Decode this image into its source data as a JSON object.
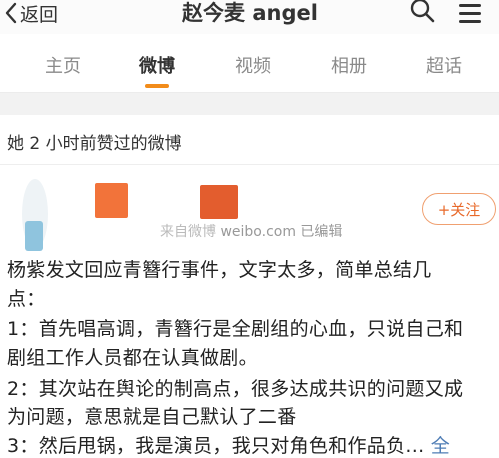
{
  "header": {
    "back_label": "返回",
    "title": "赵今麦 angel"
  },
  "tabs": [
    {
      "label": "主页",
      "active": false
    },
    {
      "label": "微博",
      "active": true
    },
    {
      "label": "视频",
      "active": false
    },
    {
      "label": "相册",
      "active": false
    },
    {
      "label": "超话",
      "active": false
    }
  ],
  "liked_section": {
    "label": "她 2 小时前赞过的微博"
  },
  "post": {
    "source_blurred": "来自微博",
    "source": "weibo.com 已编辑",
    "follow_label": "+关注",
    "lines": [
      "杨紫发文回应青簪行事件，文字太多，简单总结几",
      "点：",
      "1：首先唱高调，青簪行是全剧组的心血，只说自己和",
      "剧组工作人员都在认真做剧。",
      "2：其次站在舆论的制高点，很多达成共识的问题又成",
      "为问题，意思就是自己默认了二番",
      "3：然后甩锅，我是演员，我只对角色和作品负..."
    ],
    "more_label": "全"
  },
  "colors": {
    "accent": "#f28c1a",
    "follow": "#e8692a",
    "link": "#4f7db5"
  }
}
